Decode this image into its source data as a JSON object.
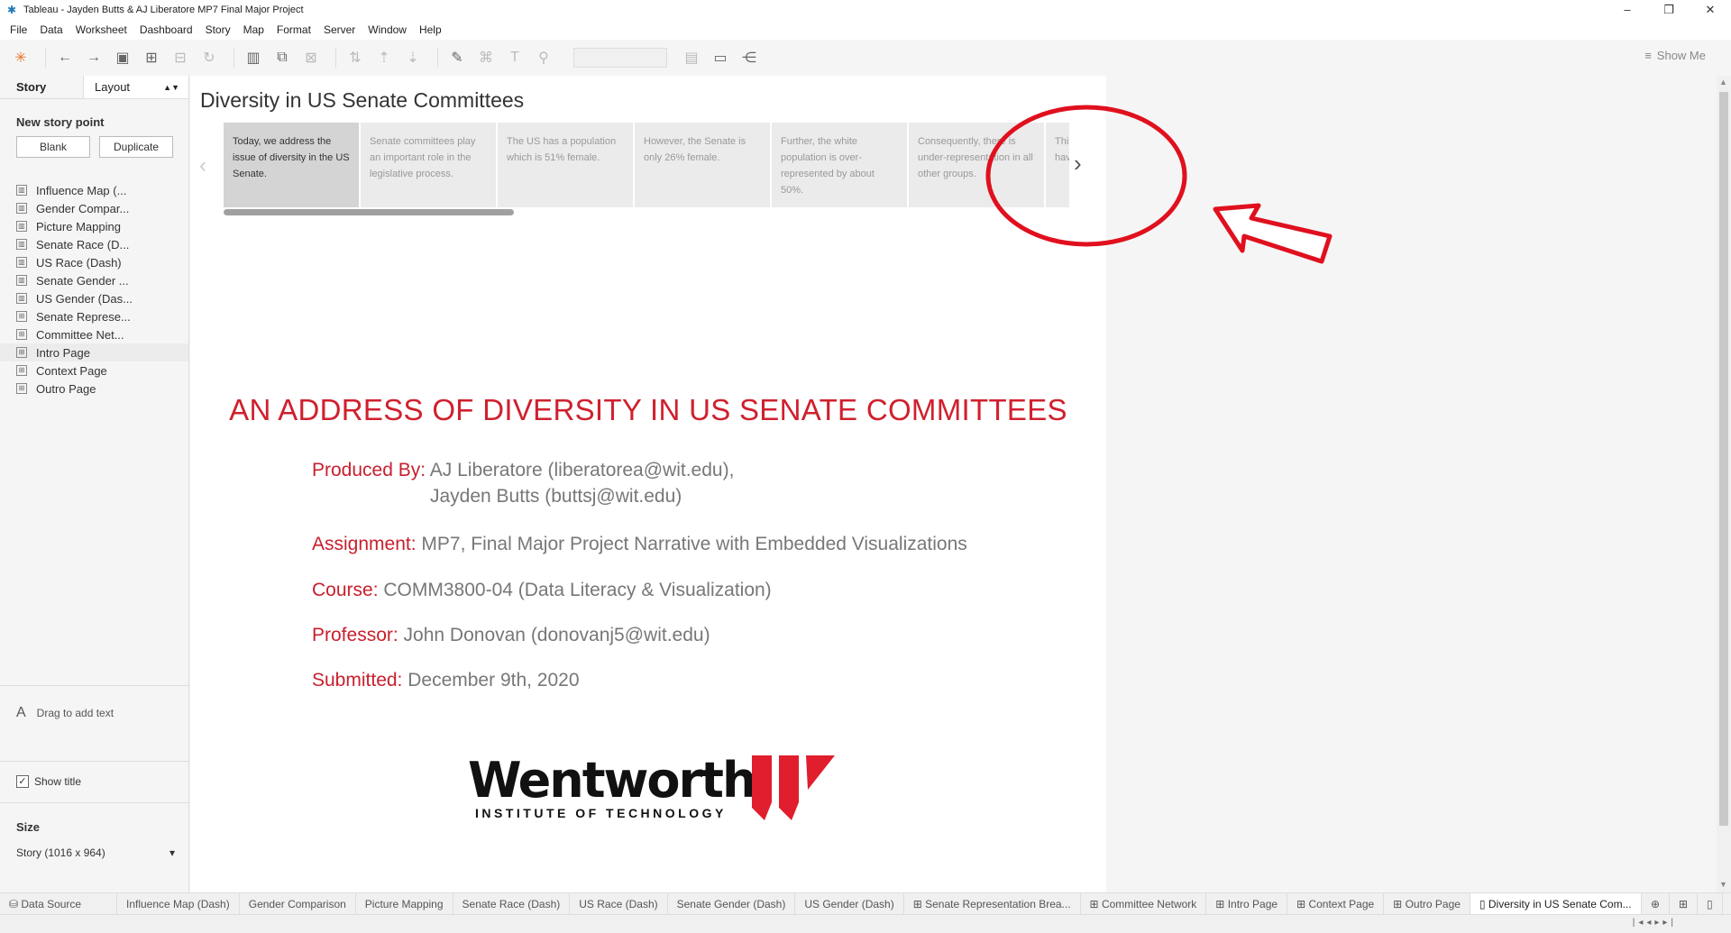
{
  "window": {
    "title": "Tableau - Jayden Butts & AJ Liberatore MP7 Final Major Project",
    "minimize": "–",
    "restore": "❐",
    "close": "✕"
  },
  "menu": [
    "File",
    "Data",
    "Worksheet",
    "Dashboard",
    "Story",
    "Map",
    "Format",
    "Server",
    "Window",
    "Help"
  ],
  "toolbar": {
    "show_me": "Show Me"
  },
  "left_pane": {
    "tab_story": "Story",
    "tab_layout": "Layout",
    "new_story_point": "New story point",
    "blank": "Blank",
    "duplicate": "Duplicate",
    "sheets": [
      "Influence Map (...",
      "Gender Compar...",
      "Picture Mapping",
      "Senate Race (D...",
      "US Race (Dash)",
      "Senate Gender ...",
      "US Gender (Das...",
      "Senate Represe...",
      "Committee Net...",
      "Intro Page",
      "Context Page",
      "Outro Page"
    ],
    "drag_text": "Drag to add text",
    "show_title": "Show title",
    "size_label": "Size",
    "size_value": "Story (1016 x 964)"
  },
  "story": {
    "title": "Diversity in US Senate Committees",
    "points": [
      "Today, we address the issue of diversity in the US Senate.",
      "Senate committees play an important role in the legislative process.",
      "The US has a population which is 51% female.",
      "However, the Senate is only 26% female.",
      "Further, the white population is over-represented by about 50%.",
      "Consequently, there is under-representation in all other groups.",
      "This proportion may have... legislation"
    ]
  },
  "content": {
    "main_title": "AN ADDRESS OF DIVERSITY IN US SENATE COMMITTEES",
    "produced_by_label": "Produced By:",
    "produced_by_1": "AJ Liberatore (liberatorea@wit.edu),",
    "produced_by_2": "Jayden Butts (buttsj@wit.edu)",
    "assignment_label": "Assignment:",
    "assignment": "MP7, Final Major Project Narrative with Embedded Visualizations",
    "course_label": "Course:",
    "course": "COMM3800-04 (Data Literacy & Visualization)",
    "professor_label": "Professor:",
    "professor": "John Donovan (donovanj5@wit.edu)",
    "submitted_label": "Submitted:",
    "submitted": "December 9th, 2020",
    "logo_word": "Wentworth",
    "logo_sub": "INSTITUTE OF TECHNOLOGY"
  },
  "tabs": [
    "Data Source",
    "Influence Map (Dash)",
    "Gender Comparison",
    "Picture Mapping",
    "Senate Race (Dash)",
    "US Race (Dash)",
    "Senate Gender (Dash)",
    "US Gender (Dash)",
    "Senate Representation Brea...",
    "Committee Network",
    "Intro Page",
    "Context Page",
    "Outro Page",
    "Diversity in US Senate Com..."
  ],
  "colors": {
    "accent_red": "#d0202e",
    "annotation_red": "#e0101e"
  }
}
